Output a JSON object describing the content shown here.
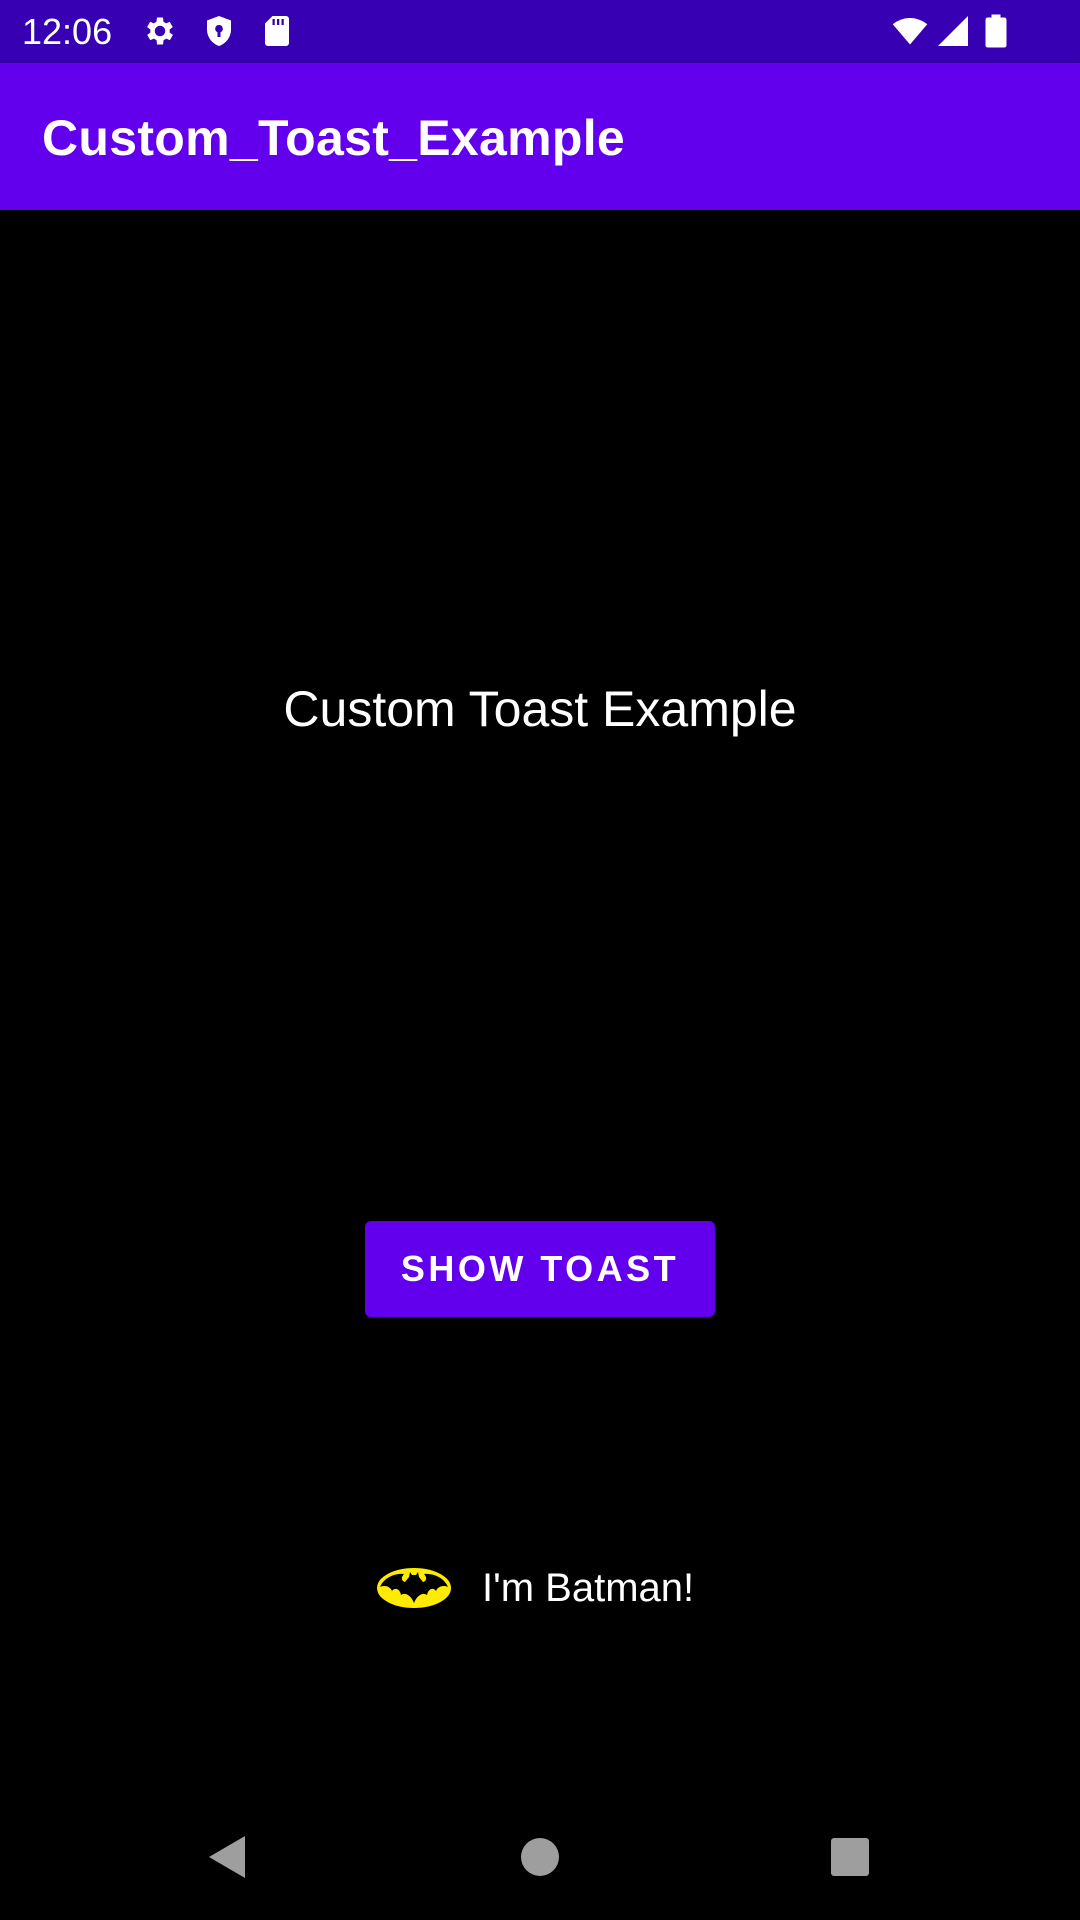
{
  "status_bar": {
    "time": "12:06",
    "icons": [
      "gear-icon",
      "shield-icon",
      "sd-card-icon",
      "wifi-icon",
      "signal-icon",
      "battery-icon"
    ]
  },
  "app_bar": {
    "title": "Custom_Toast_Example"
  },
  "main": {
    "heading": "Custom Toast Example",
    "button_label": "SHOW TOAST"
  },
  "toast": {
    "icon": "batman-logo-icon",
    "text": "I'm Batman!"
  },
  "nav_bar": {
    "buttons": [
      "back-icon",
      "home-icon",
      "recents-icon"
    ]
  },
  "colors": {
    "status_bar": "#3700b3",
    "primary": "#6200ee",
    "background": "#000000",
    "batman_yellow": "#ffeb00"
  }
}
